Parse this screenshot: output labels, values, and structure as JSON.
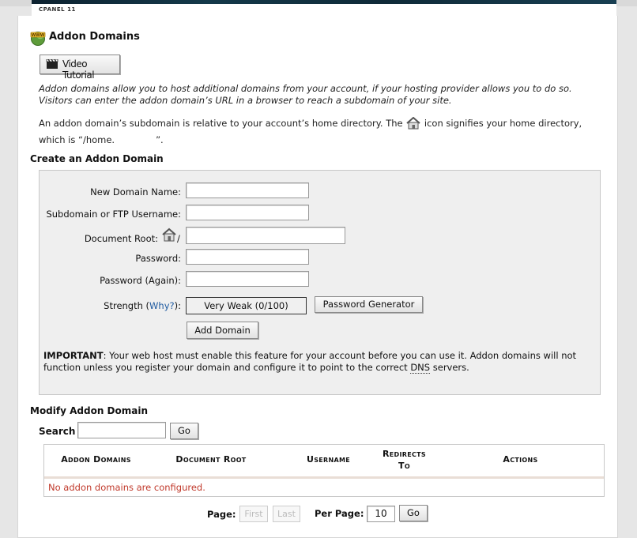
{
  "header": {
    "brand": "CPANEL 11"
  },
  "page": {
    "title": "Addon Domains",
    "video_tutorial": "Video Tutorial",
    "intro": "Addon domains allow you to host additional domains from your account, if your hosting provider allows you to do so. Visitors can enter the addon domain’s URL in a browser to reach a subdomain of your site.",
    "home_text_1": "An addon domain’s subdomain is relative to your account’s home directory. The",
    "home_text_2": "icon signifies your home directory, which is “/home.",
    "home_text_3": "”."
  },
  "create": {
    "heading": "Create an Addon Domain",
    "new_domain_label": "New Domain Name:",
    "new_domain_value": "",
    "subdomain_label": "Subdomain or FTP Username:",
    "subdomain_value": "",
    "docroot_label": "Document Root:",
    "docroot_slash": "/",
    "docroot_value": "",
    "password_label": "Password:",
    "password_again_label": "Password (Again):",
    "strength_label": "Strength (",
    "why_link": "Why?",
    "strength_close": "):",
    "strength_value": "Very Weak (0/100)",
    "generator_button": "Password Generator",
    "add_button": "Add Domain",
    "important_label": "IMPORTANT",
    "important_text": ": Your web host must enable this feature for your account before you can use it. Addon domains will not function unless you register your domain and configure it to point to the correct ",
    "dns": "DNS",
    "important_end": " servers."
  },
  "modify": {
    "heading": "Modify Addon Domain",
    "search_label": "Search",
    "search_value": "",
    "go_button": "Go",
    "columns": [
      "Addon Domains",
      "Document Root",
      "Username",
      "Redirects",
      "To",
      "Actions"
    ],
    "empty_message": "No addon domains are configured.",
    "page_label": "Page:",
    "first_button": "First",
    "last_button": "Last",
    "per_page_label": "Per Page:",
    "per_page_value": "10",
    "per_page_go": "Go"
  }
}
